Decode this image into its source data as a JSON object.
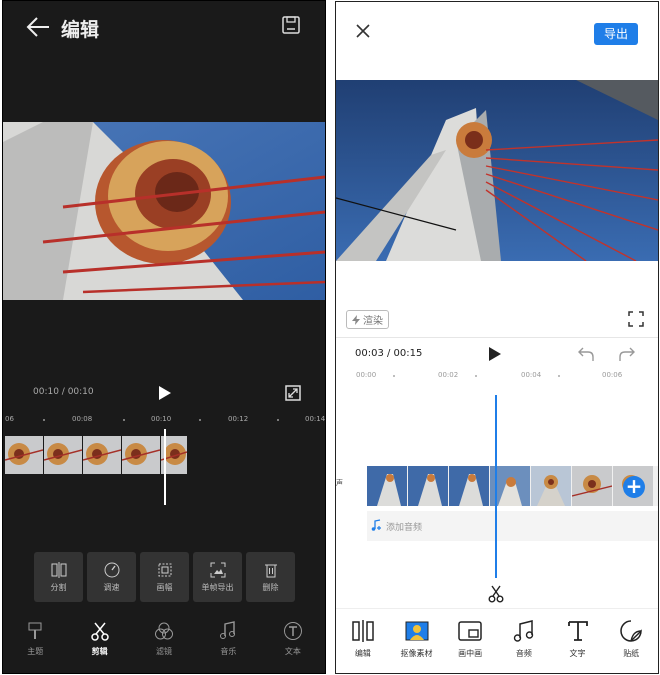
{
  "left": {
    "header": {
      "title": "编辑",
      "back_icon": "back-arrow-icon",
      "save_icon": "save-icon"
    },
    "player": {
      "time": "00:10 / 00:10",
      "play_icon": "play-icon",
      "fullscreen_icon": "fullscreen-icon"
    },
    "ruler": [
      "06",
      "00:08",
      "00:10",
      "00:12",
      "00:14"
    ],
    "tools": [
      {
        "label": "分割",
        "icon": "split-icon"
      },
      {
        "label": "调速",
        "icon": "speed-icon"
      },
      {
        "label": "画幅",
        "icon": "aspect-ratio-icon"
      },
      {
        "label": "单帧导出",
        "icon": "frame-export-icon"
      },
      {
        "label": "删除",
        "icon": "delete-icon"
      }
    ],
    "nav": [
      {
        "label": "主题",
        "icon": "theme-icon"
      },
      {
        "label": "剪辑",
        "icon": "scissors-icon",
        "active": true
      },
      {
        "label": "滤镜",
        "icon": "filter-icon"
      },
      {
        "label": "音乐",
        "icon": "music-icon"
      },
      {
        "label": "文本",
        "icon": "text-icon"
      }
    ]
  },
  "right": {
    "header": {
      "close_icon": "close-icon",
      "export_label": "导出"
    },
    "render_label": "渲染",
    "player": {
      "time": "00:03 / 00:15"
    },
    "ruler": [
      "00:00",
      "00:02",
      "00:04",
      "00:06"
    ],
    "volume_label": "声",
    "audio_label": "添加音频",
    "add_label": "+",
    "nav": [
      {
        "label": "编辑",
        "icon": "edit-split-icon"
      },
      {
        "label": "抠像素材",
        "icon": "portrait-matting-icon"
      },
      {
        "label": "画中画",
        "icon": "picture-in-picture-icon"
      },
      {
        "label": "音频",
        "icon": "audio-icon"
      },
      {
        "label": "文字",
        "icon": "text-icon"
      },
      {
        "label": "贴纸",
        "icon": "sticker-icon"
      }
    ]
  },
  "colors": {
    "accent": "#1f7ee8",
    "dark_bg": "#1a1a1a",
    "tool_bg": "#333333"
  }
}
